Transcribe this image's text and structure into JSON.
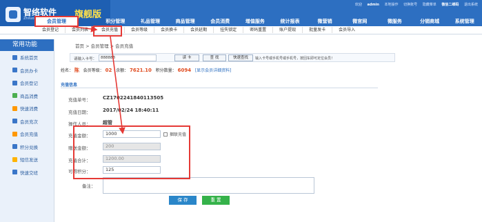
{
  "app": {
    "name": "智络软件",
    "sub": "Zhiluo Software",
    "edition": "旗舰版"
  },
  "top_links": [
    "欢迎",
    "admin",
    "本地操作",
    "切换账号",
    "隐藏菜单",
    "微信二维码",
    "退出系统"
  ],
  "main_nav": {
    "active": "会员管理",
    "items": [
      "积分管理",
      "礼品管理",
      "商品管理",
      "会员消费",
      "增值服务",
      "统计报表",
      "微营销",
      "微官网",
      "微服务",
      "分销商城",
      "系统管理"
    ]
  },
  "sub_nav": [
    "会员登记",
    "会员列表",
    "会员充值",
    "会员等级",
    "会员换卡",
    "会员延期",
    "挂失锁定",
    "密码重置",
    "账户提现",
    "批量发卡",
    "会员导入"
  ],
  "sidebar": {
    "title": "常用功能",
    "items": [
      {
        "label": "系统首页",
        "color": "#3a76c8"
      },
      {
        "label": "会员办卡",
        "color": "#3a76c8"
      },
      {
        "label": "会员登记",
        "color": "#3a76c8"
      },
      {
        "label": "商品消费",
        "color": "#4caf50"
      },
      {
        "label": "快速消费",
        "color": "#ff9800"
      },
      {
        "label": "会员充次",
        "color": "#3a76c8"
      },
      {
        "label": "会员充值",
        "color": "#ff9800"
      },
      {
        "label": "积分兑换",
        "color": "#3a76c8"
      },
      {
        "label": "短信发送",
        "color": "#ffb300"
      },
      {
        "label": "快速交班",
        "color": "#3a76c8"
      }
    ]
  },
  "breadcrumb": "首页  >  会员管理  >  会员充值",
  "search": {
    "label": "请输入卡号：",
    "value": "888888",
    "btn_read": "读 卡",
    "btn_find": "查 找",
    "btn_adv": "快速查找",
    "hint": "输入卡号或手机号或手机号，按回车即可定位会员！"
  },
  "member_info": {
    "name_label": "姓名：",
    "name": "陈",
    "level_label": "会员等级：",
    "level": "02",
    "balance_label": "余额：",
    "balance": "7621.10",
    "points_label": "积分数量：",
    "points": "6094",
    "detail_link": "[显示会员详细资料]"
  },
  "panel": {
    "title": "充值信息",
    "order_no_label": "充值单号：",
    "order_no": "CZ1702241840113505",
    "date_label": "充值日期：",
    "date": "2017/02/24 18:40:11",
    "operator_label": "操作人员：",
    "operator": "超管",
    "amount_label": "充值金额：",
    "amount": "1000",
    "gift_label": "赠送金额：",
    "gift": "200",
    "total_label": "充值合计：",
    "total": "1200.00",
    "points_label": "可得积分：",
    "points": "125",
    "checkbox_label": "捆联充值",
    "remark_label": "备注：",
    "btn_save": "保 存",
    "btn_reset": "重 置"
  }
}
